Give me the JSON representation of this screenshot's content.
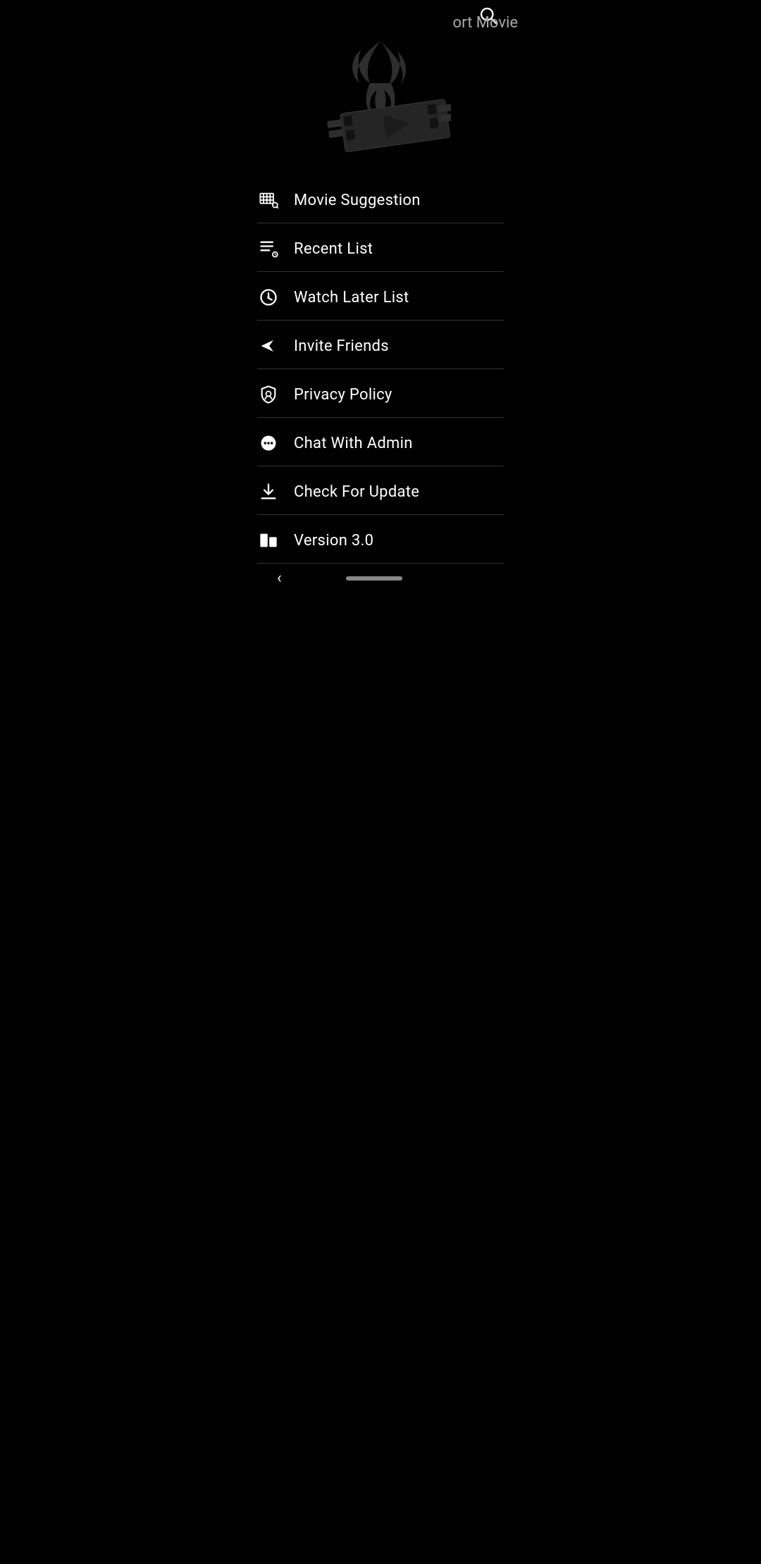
{
  "header": {
    "search_label": "Search",
    "top_right_partial": "ort Movie"
  },
  "menu": {
    "items": [
      {
        "id": "movie-suggestion",
        "label": "Movie Suggestion",
        "icon": "movie-suggestion-icon"
      },
      {
        "id": "recent-list",
        "label": "Recent List",
        "icon": "recent-list-icon"
      },
      {
        "id": "watch-later",
        "label": "Watch Later List",
        "icon": "watch-later-icon"
      },
      {
        "id": "invite-friends",
        "label": "Invite Friends",
        "icon": "invite-friends-icon"
      },
      {
        "id": "privacy-policy",
        "label": "Privacy Policy",
        "icon": "privacy-policy-icon"
      },
      {
        "id": "chat-with-admin",
        "label": "Chat With Admin",
        "icon": "chat-admin-icon"
      },
      {
        "id": "check-for-update",
        "label": "Check For Update",
        "icon": "update-icon"
      },
      {
        "id": "version",
        "label": "Version 3.0",
        "icon": "version-icon"
      }
    ]
  },
  "bottom_nav": {
    "back_label": "‹"
  }
}
